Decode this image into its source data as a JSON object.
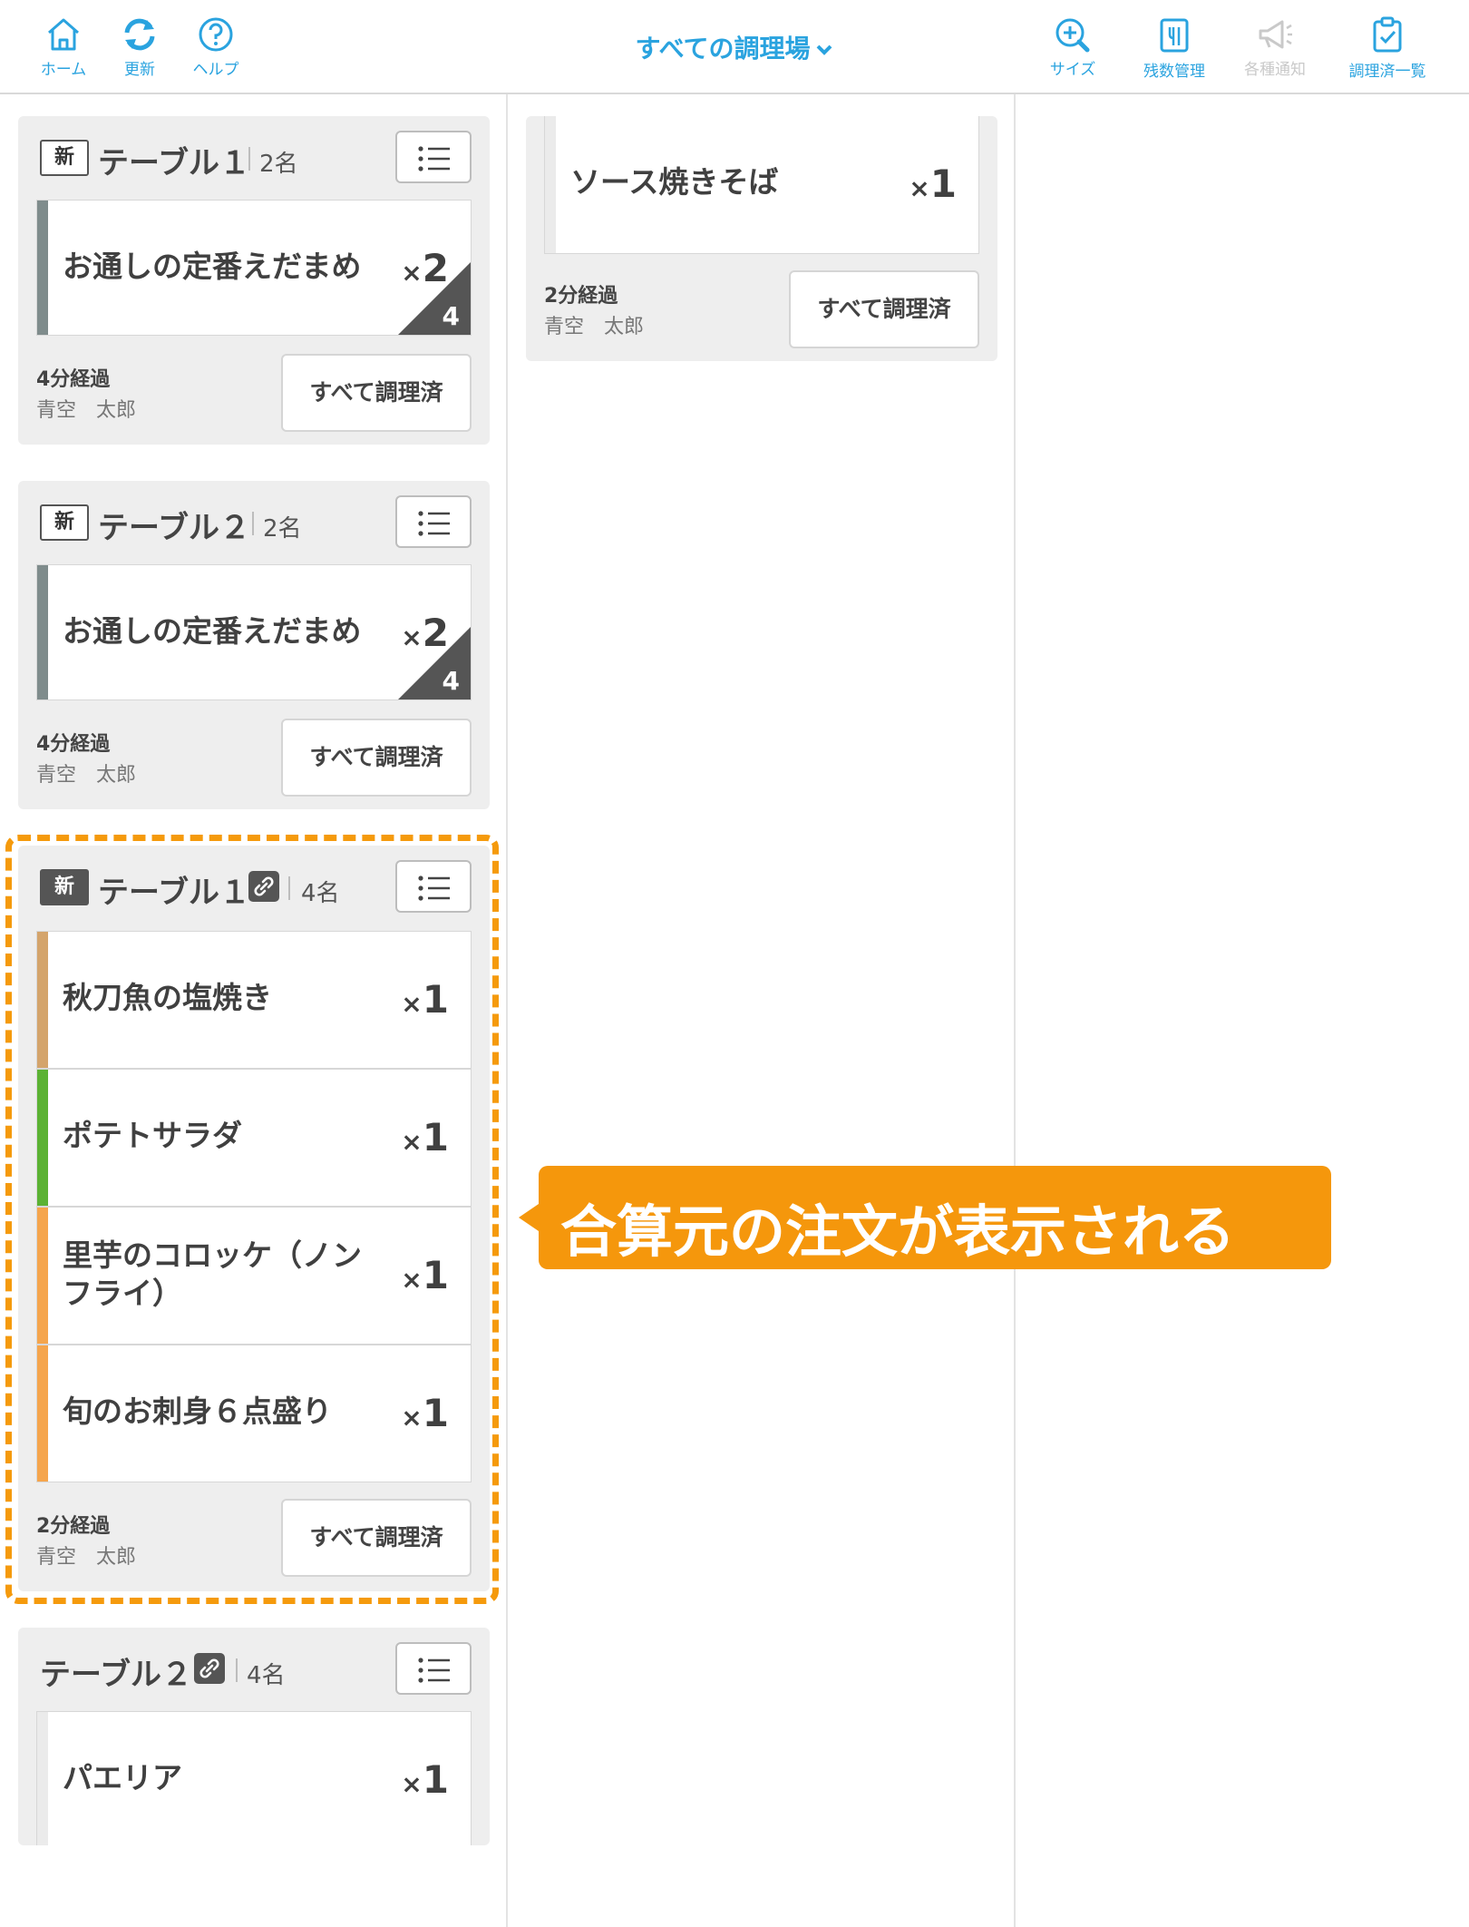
{
  "header": {
    "home_label": "ホーム",
    "refresh_label": "更新",
    "help_label": "ヘルプ",
    "station": "すべての調理場",
    "size_label": "サイズ",
    "stock_label": "残数管理",
    "notify_label": "各種通知",
    "done_list_label": "調理済一覧"
  },
  "colors": {
    "accent": "#2aa3df",
    "annotation": "#f5970c",
    "item_grey": "#7f8c8c",
    "item_tan": "#d4a46b",
    "item_green": "#5bb233",
    "item_orange": "#f5a54c"
  },
  "cards": [
    {
      "badge": "新",
      "table": "テーブル１",
      "guests": "2名",
      "items": [
        {
          "name": "お通しの定番えだまめ",
          "qty_prefix": "×",
          "qty": "2",
          "total": "4"
        }
      ],
      "elapsed": "4分経過",
      "staff": "青空　太郎",
      "button": "すべて調理済"
    },
    {
      "badge": "新",
      "table": "テーブル２",
      "guests": "2名",
      "items": [
        {
          "name": "お通しの定番えだまめ",
          "qty_prefix": "×",
          "qty": "2",
          "total": "4"
        }
      ],
      "elapsed": "4分経過",
      "staff": "青空　太郎",
      "button": "すべて調理済"
    },
    {
      "badge": "新",
      "table": "テーブル１",
      "guests": "4名",
      "items": [
        {
          "name": "秋刀魚の塩焼き",
          "qty_prefix": "×",
          "qty": "1"
        },
        {
          "name": "ポテトサラダ",
          "qty_prefix": "×",
          "qty": "1"
        },
        {
          "name": "里芋のコロッケ（ノンフライ）",
          "qty_prefix": "×",
          "qty": "1"
        },
        {
          "name": "旬のお刺身６点盛り",
          "qty_prefix": "×",
          "qty": "1"
        }
      ],
      "elapsed": "2分経過",
      "staff": "青空　太郎",
      "button": "すべて調理済"
    },
    {
      "table": "テーブル２",
      "guests": "4名",
      "items": [
        {
          "name": "パエリア",
          "qty_prefix": "×",
          "qty": "1"
        }
      ]
    },
    {
      "items": [
        {
          "name": "ソース焼きそば",
          "qty_prefix": "×",
          "qty": "1"
        }
      ],
      "elapsed": "2分経過",
      "staff": "青空　太郎",
      "button": "すべて調理済"
    }
  ],
  "annotation": {
    "callout": "合算元の注文が表示される"
  }
}
